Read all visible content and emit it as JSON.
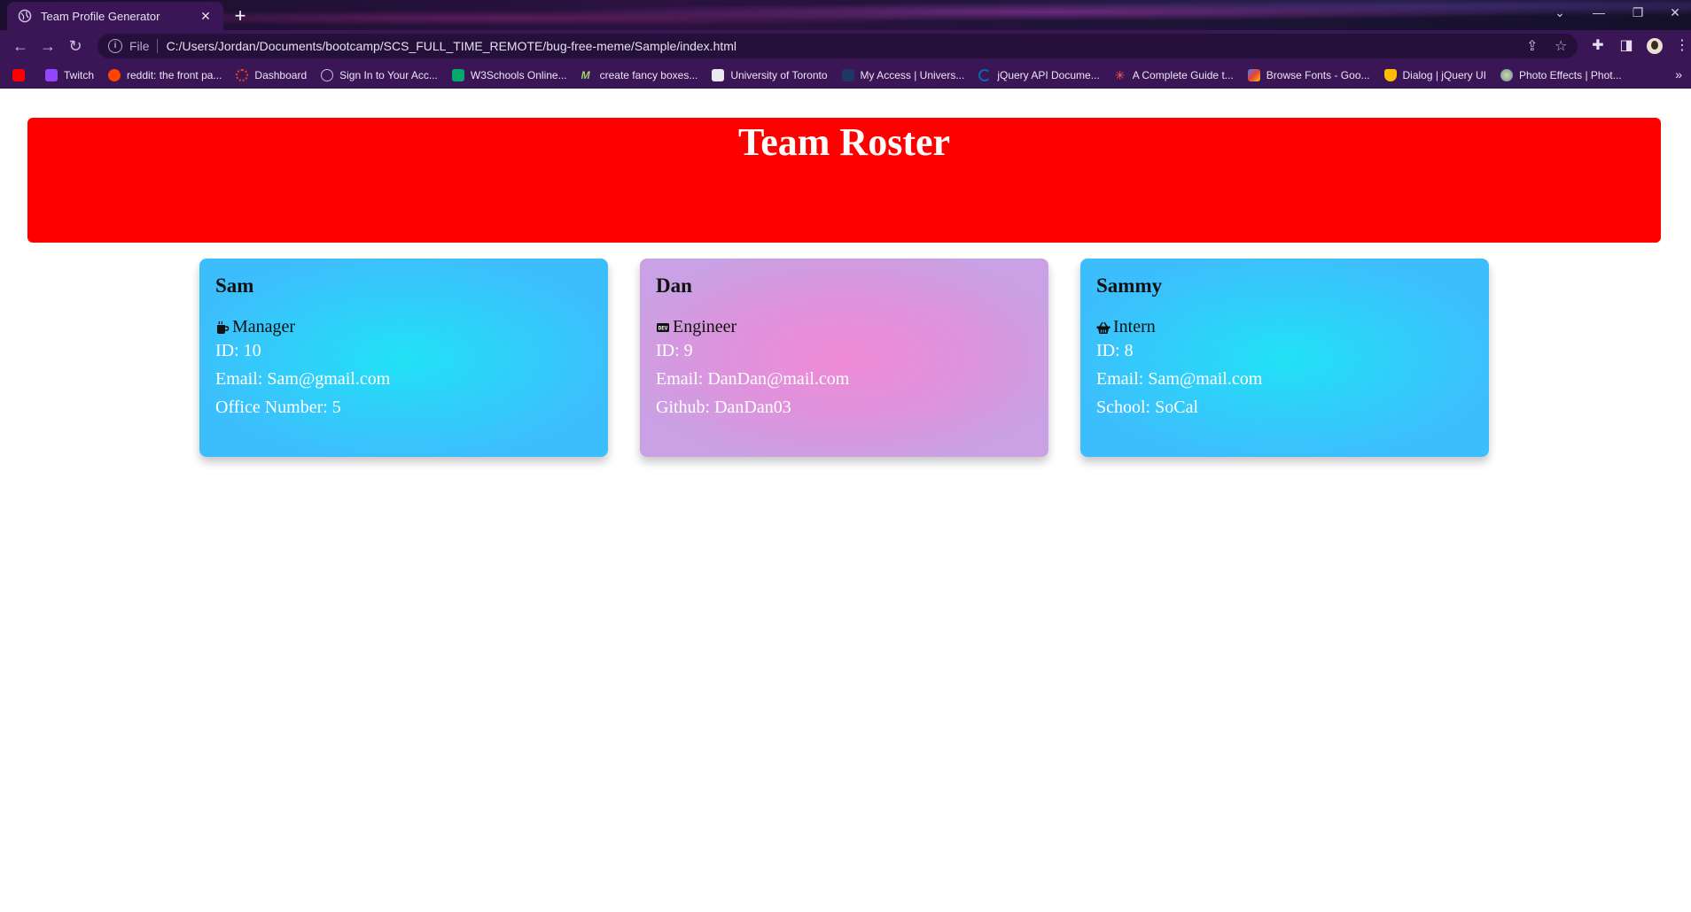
{
  "browser": {
    "tab_title": "Team Profile Generator",
    "url_scheme": "File",
    "url": "C:/Users/Jordan/Documents/bootcamp/SCS_FULL_TIME_REMOTE/bug-free-meme/Sample/index.html",
    "bookmarks": [
      {
        "label": "",
        "icon": "youtube-icon",
        "color": "#ff0000"
      },
      {
        "label": "Twitch",
        "icon": "twitch-icon",
        "color": "#9146ff"
      },
      {
        "label": "reddit: the front pa...",
        "icon": "reddit-icon",
        "color": "#ff4500"
      },
      {
        "label": "Dashboard",
        "icon": "dashboard-icon",
        "color": "#e8431c"
      },
      {
        "label": "Sign In to Your Acc...",
        "icon": "globe-icon",
        "color": "#c9bcd9"
      },
      {
        "label": "W3Schools Online...",
        "icon": "w3schools-icon",
        "color": "#04aa6d"
      },
      {
        "label": "create fancy boxes...",
        "icon": "m-icon",
        "color": "#9fd36a"
      },
      {
        "label": "University of Toronto",
        "icon": "uoft-icon",
        "color": "#e8e8f0"
      },
      {
        "label": "My Access | Univers...",
        "icon": "myaccess-icon",
        "color": "#1e3765"
      },
      {
        "label": "jQuery API Docume...",
        "icon": "jquery-icon",
        "color": "#0769ad"
      },
      {
        "label": "A Complete Guide t...",
        "icon": "star-burst-icon",
        "color": "#ff5a4a"
      },
      {
        "label": "Browse Fonts - Goo...",
        "icon": "google-fonts-icon",
        "color": "#4285f4"
      },
      {
        "label": "Dialog | jQuery UI",
        "icon": "jqueryui-icon",
        "color": "#fbbc05"
      },
      {
        "label": "Photo Effects | Phot...",
        "icon": "photo-effects-icon",
        "color": "#8ab4a0"
      }
    ]
  },
  "page": {
    "title": "Team Roster",
    "cards": [
      {
        "name": "Sam",
        "role": "Manager",
        "role_icon": "mug-icon",
        "id": "ID: 10",
        "email": "Email: Sam@gmail.com",
        "extra": "Office Number: 5"
      },
      {
        "name": "Dan",
        "role": "Engineer",
        "role_icon": "dev-icon",
        "id": "ID: 9",
        "email": "Email: DanDan@mail.com",
        "extra": "Github: DanDan03"
      },
      {
        "name": "Sammy",
        "role": "Intern",
        "role_icon": "basket-icon",
        "id": "ID: 8",
        "email": "Email: Sam@mail.com",
        "extra": "School: SoCal"
      }
    ]
  }
}
